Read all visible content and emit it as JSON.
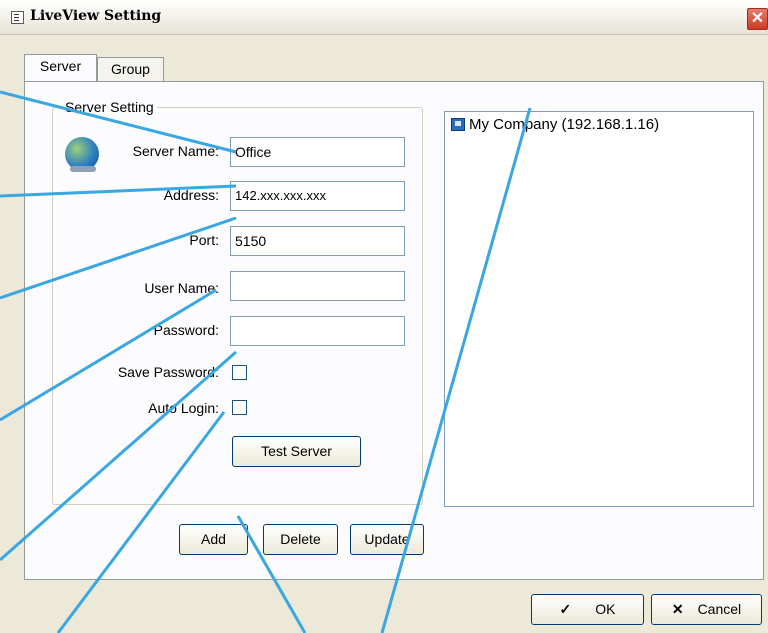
{
  "window": {
    "title": "LiveView Setting",
    "close_glyph": "✕"
  },
  "tabs": [
    {
      "label": "Server",
      "active": true
    },
    {
      "label": "Group",
      "active": false
    }
  ],
  "server_setting": {
    "group_label": "Server Setting",
    "server_name": {
      "label": "Server Name:",
      "value": "Office"
    },
    "address": {
      "label": "Address:",
      "value": "142.xxx.xxx.xxx"
    },
    "port": {
      "label": "Port:",
      "value": "5150"
    },
    "user_name": {
      "label": "User Name:",
      "value": ""
    },
    "password": {
      "label": "Password:",
      "value": ""
    },
    "save_password": {
      "label": "Save Password:",
      "checked": false
    },
    "auto_login": {
      "label": "Auto Login:",
      "checked": false
    },
    "test_button": "Test Server"
  },
  "actions": {
    "add": "Add",
    "delete": "Delete",
    "update": "Update"
  },
  "server_tree": {
    "items": [
      {
        "label": "My Company (192.168.1.16)",
        "icon": "server-monitor-icon"
      }
    ]
  },
  "footer": {
    "ok": "OK",
    "ok_icon": "checkmark-icon",
    "cancel": "Cancel",
    "cancel_icon": "x-icon"
  },
  "colors": {
    "callout_line": "#3aa6e2",
    "panel_bg": "#ece9d8"
  }
}
